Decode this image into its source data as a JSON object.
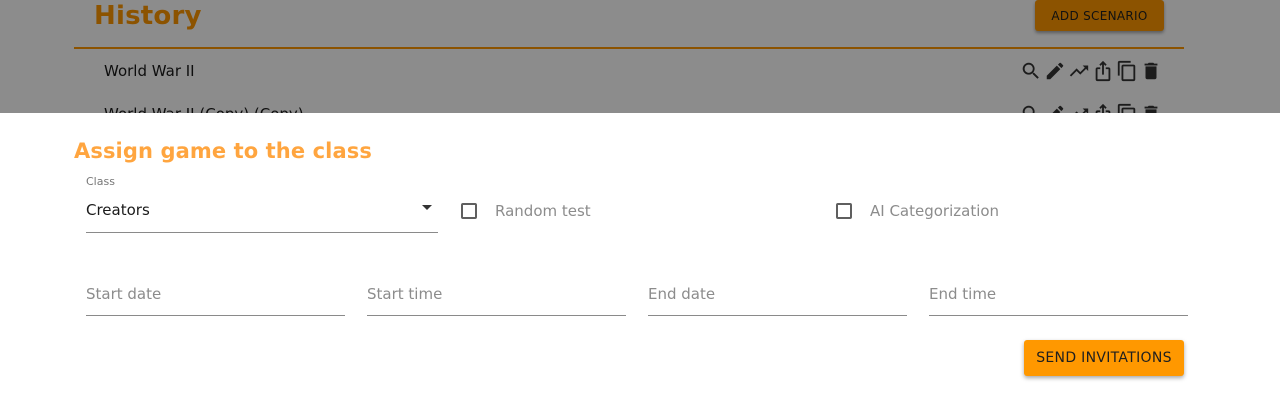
{
  "background": {
    "section_title": "History",
    "add_button_label": "ADD SCENARIO",
    "rows": [
      {
        "label": "World War II"
      },
      {
        "label": "World War II (Copy) (Copy)"
      }
    ],
    "row_actions": [
      "search-icon",
      "edit-icon",
      "trending-up-icon",
      "share-icon",
      "copy-icon",
      "delete-icon"
    ]
  },
  "dialog": {
    "title": "Assign game to the class",
    "class_field": {
      "label": "Class",
      "value": "Creators"
    },
    "random_test": {
      "label": "Random test",
      "checked": false
    },
    "ai_categorization": {
      "label": "AI Categorization",
      "checked": false
    },
    "start_date": {
      "placeholder": "Start date"
    },
    "start_time": {
      "placeholder": "Start time"
    },
    "end_date": {
      "placeholder": "End date"
    },
    "end_time": {
      "placeholder": "End time"
    },
    "send_button_label": "SEND INVITATIONS"
  },
  "colors": {
    "accent": "#ff9800",
    "title": "#ffa53f",
    "overlay": "rgba(0,0,0,0.45)"
  }
}
